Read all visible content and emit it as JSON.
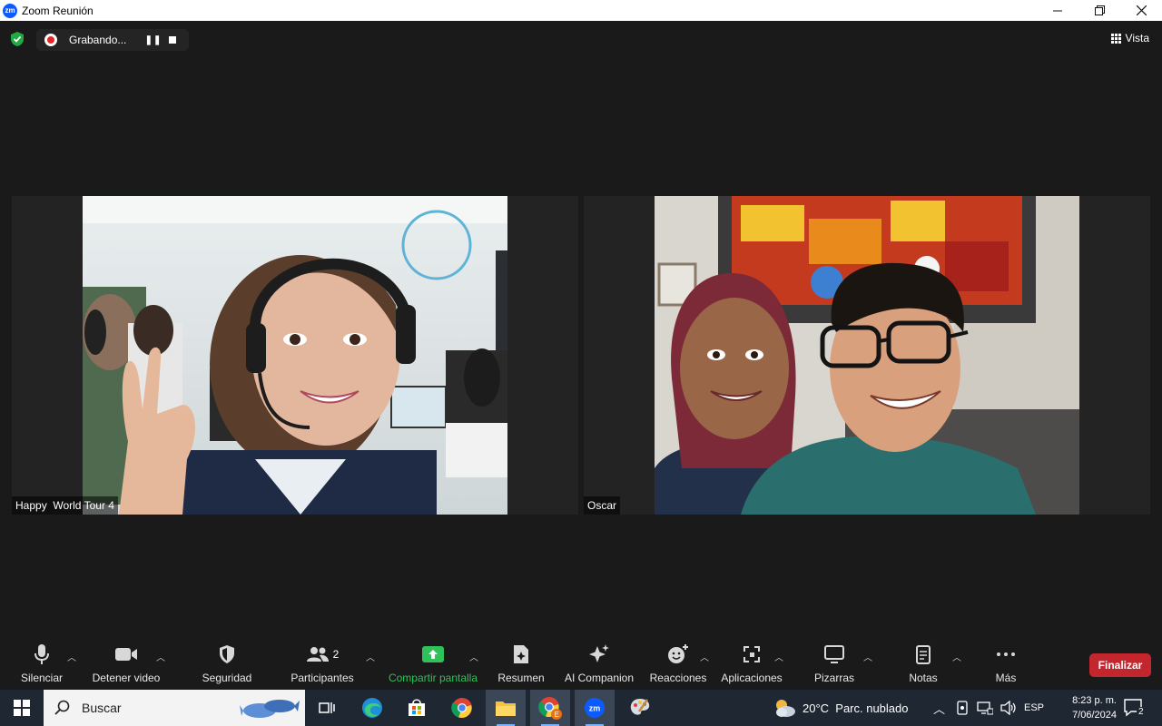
{
  "window": {
    "app_logo": "zm",
    "title": "Zoom Reunión",
    "controls": [
      "minimize-icon",
      "restore-icon",
      "close-icon"
    ]
  },
  "topbar": {
    "security_icon": "green-shield-icon",
    "recording_label": "Grabando...",
    "view_label": "Vista"
  },
  "participants": [
    {
      "name": "Happy  World Tour 4"
    },
    {
      "name": "Oscar"
    }
  ],
  "toolbar": {
    "mute": "Silenciar",
    "video": "Detener video",
    "security": "Seguridad",
    "participants": "Participantes",
    "participants_count": "2",
    "share": "Compartir pantalla",
    "summary": "Resumen",
    "ai": "AI Companion",
    "reactions": "Reacciones",
    "apps": "Aplicaciones",
    "whiteboards": "Pizarras",
    "notes": "Notas",
    "more": "Más",
    "end": "Finalizar",
    "share_color": "#30c15a",
    "end_color": "#c4262e"
  },
  "taskbar": {
    "search_placeholder": "Buscar",
    "weather": "20°C  Parc. nublado",
    "language": "ESP",
    "time": "8:23 p. m.",
    "date": "7/06/2024",
    "notifications": "2",
    "zoom_logo": "zm",
    "chrome_badge": "E"
  }
}
